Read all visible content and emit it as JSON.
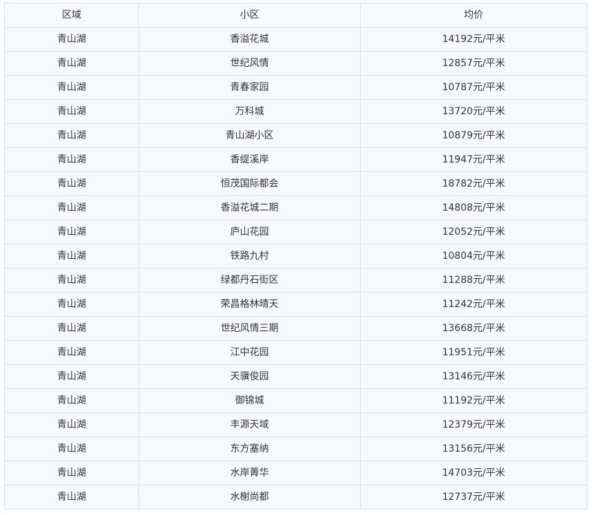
{
  "table": {
    "headers": [
      "区域",
      "小区",
      "均价"
    ],
    "rows": [
      [
        "青山湖",
        "香溢花城",
        "14192元/平米"
      ],
      [
        "青山湖",
        "世纪风情",
        "12857元/平米"
      ],
      [
        "青山湖",
        "青春家园",
        "10787元/平米"
      ],
      [
        "青山湖",
        "万科城",
        "13720元/平米"
      ],
      [
        "青山湖",
        "青山湖小区",
        "10879元/平米"
      ],
      [
        "青山湖",
        "香缇溪岸",
        "11947元/平米"
      ],
      [
        "青山湖",
        "恒茂国际都会",
        "18782元/平米"
      ],
      [
        "青山湖",
        "香溢花城二期",
        "14808元/平米"
      ],
      [
        "青山湖",
        "庐山花园",
        "12052元/平米"
      ],
      [
        "青山湖",
        "铁路九村",
        "10804元/平米"
      ],
      [
        "青山湖",
        "绿都丹石街区",
        "11288元/平米"
      ],
      [
        "青山湖",
        "荣昌格林晴天",
        "11242元/平米"
      ],
      [
        "青山湖",
        "世纪风情三期",
        "13668元/平米"
      ],
      [
        "青山湖",
        "江中花园",
        "11951元/平米"
      ],
      [
        "青山湖",
        "天骥俊园",
        "13146元/平米"
      ],
      [
        "青山湖",
        "御锦城",
        "11192元/平米"
      ],
      [
        "青山湖",
        "丰源天域",
        "12379元/平米"
      ],
      [
        "青山湖",
        "东方塞纳",
        "13156元/平米"
      ],
      [
        "青山湖",
        "水岸菁华",
        "14703元/平米"
      ],
      [
        "青山湖",
        "水榭尚都",
        "12737元/平米"
      ]
    ]
  },
  "colors": {
    "border": "#cfe3ef",
    "row_background": "#f6fafd",
    "text": "#333333"
  }
}
